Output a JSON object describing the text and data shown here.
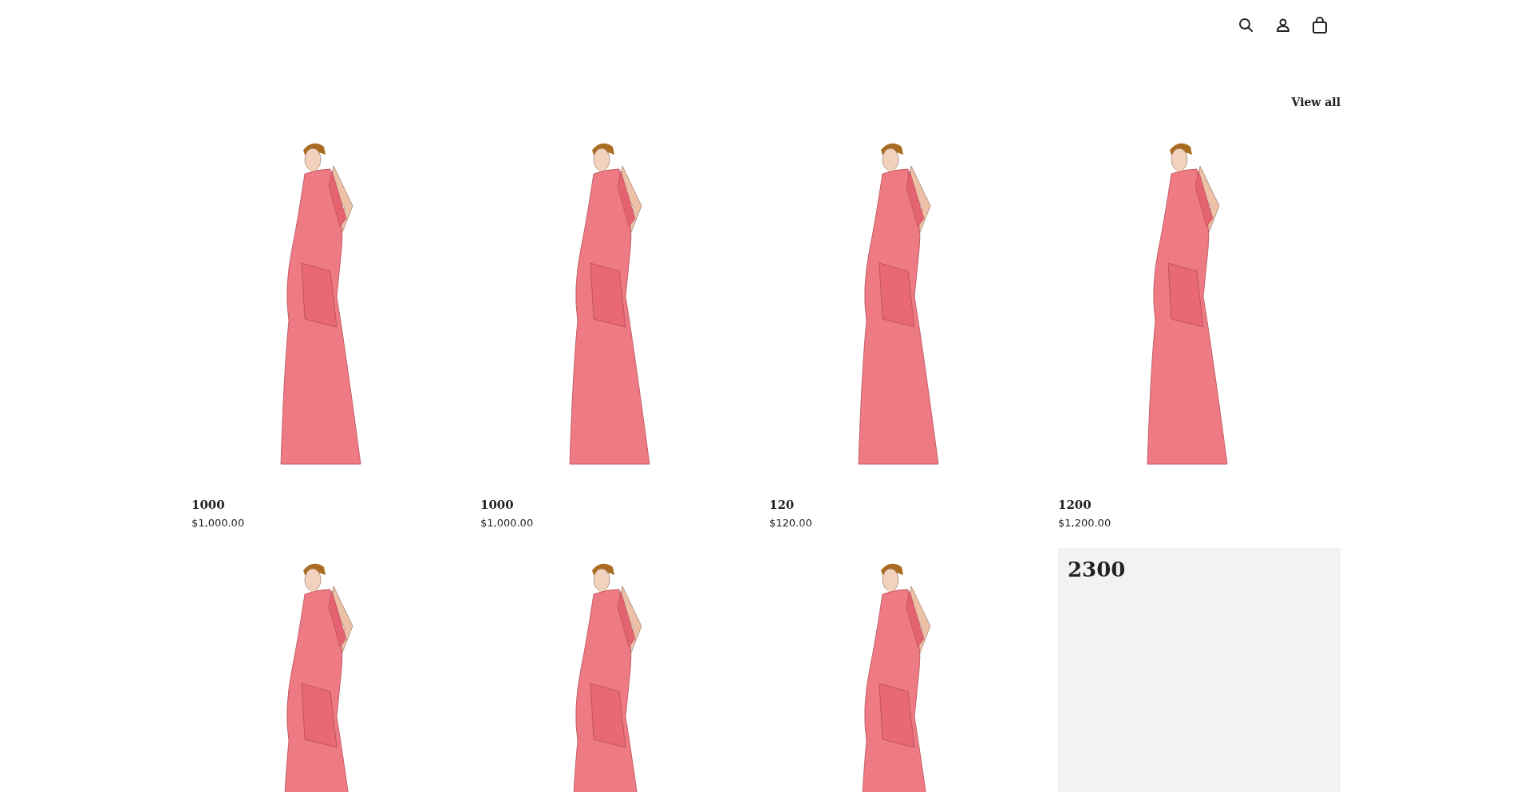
{
  "header": {
    "icons": [
      {
        "kind": "search"
      },
      {
        "kind": "account"
      },
      {
        "kind": "bag"
      }
    ]
  },
  "collection": {
    "link": "View all",
    "products": [
      {
        "kind": "image",
        "title": "1000",
        "price": "$1,000.00"
      },
      {
        "kind": "image",
        "title": "1000",
        "price": "$1,000.00"
      },
      {
        "kind": "image",
        "title": "120",
        "price": "$120.00"
      },
      {
        "kind": "image",
        "title": "1200",
        "price": "$1,200.00"
      },
      {
        "kind": "image"
      },
      {
        "kind": "image"
      },
      {
        "kind": "image"
      },
      {
        "kind": "text",
        "title": "2300"
      }
    ]
  }
}
